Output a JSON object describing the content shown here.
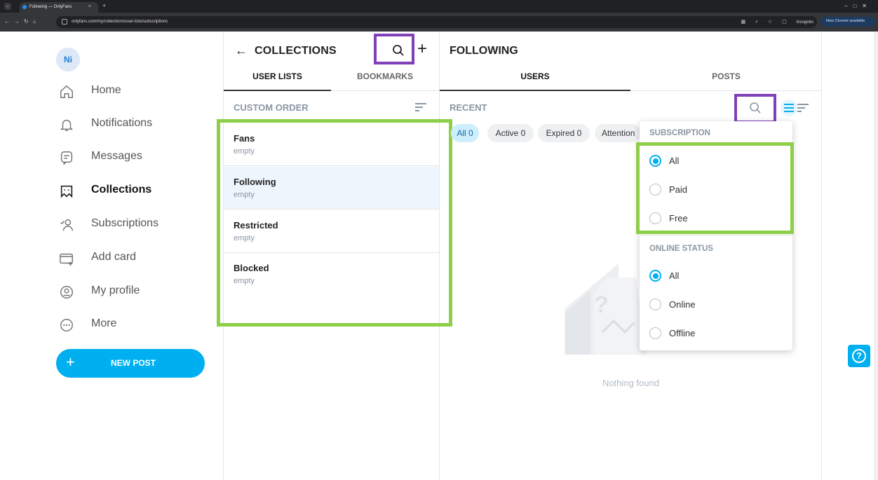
{
  "browser": {
    "tab_title": "Following — OnlyFans",
    "tab_close": "×",
    "new_tab": "+",
    "url": "onlyfans.com/my/collections/user-lists/subscriptions",
    "incognito": "Incognito",
    "new_chrome": "New Chrome available"
  },
  "sidebar": {
    "avatar_initials": "Ni",
    "items": [
      {
        "label": "Home",
        "icon": "home-icon"
      },
      {
        "label": "Notifications",
        "icon": "bell-icon"
      },
      {
        "label": "Messages",
        "icon": "message-icon"
      },
      {
        "label": "Collections",
        "icon": "collections-icon"
      },
      {
        "label": "Subscriptions",
        "icon": "subscriptions-icon"
      },
      {
        "label": "Add card",
        "icon": "card-icon"
      },
      {
        "label": "My profile",
        "icon": "profile-icon"
      },
      {
        "label": "More",
        "icon": "more-icon"
      }
    ],
    "new_post": "NEW POST"
  },
  "collections": {
    "title": "COLLECTIONS",
    "tabs": [
      "USER LISTS",
      "BOOKMARKS"
    ],
    "sort_label": "CUSTOM ORDER",
    "lists": [
      {
        "name": "Fans",
        "status": "empty"
      },
      {
        "name": "Following",
        "status": "empty"
      },
      {
        "name": "Restricted",
        "status": "empty"
      },
      {
        "name": "Blocked",
        "status": "empty"
      }
    ]
  },
  "following": {
    "title": "FOLLOWING",
    "tabs": [
      "USERS",
      "POSTS"
    ],
    "sort_label": "RECENT",
    "chips": [
      "All 0",
      "Active 0",
      "Expired 0",
      "Attention"
    ],
    "empty_text": "Nothing found"
  },
  "filter_dropdown": {
    "subscription_heading": "SUBSCRIPTION",
    "subscription_options": [
      "All",
      "Paid",
      "Free"
    ],
    "online_heading": "ONLINE STATUS",
    "online_options": [
      "All",
      "Online",
      "Offline"
    ]
  },
  "colors": {
    "accent": "#00aff0",
    "highlight_purple": "#8040b8",
    "highlight_green": "#8ecf4a"
  }
}
